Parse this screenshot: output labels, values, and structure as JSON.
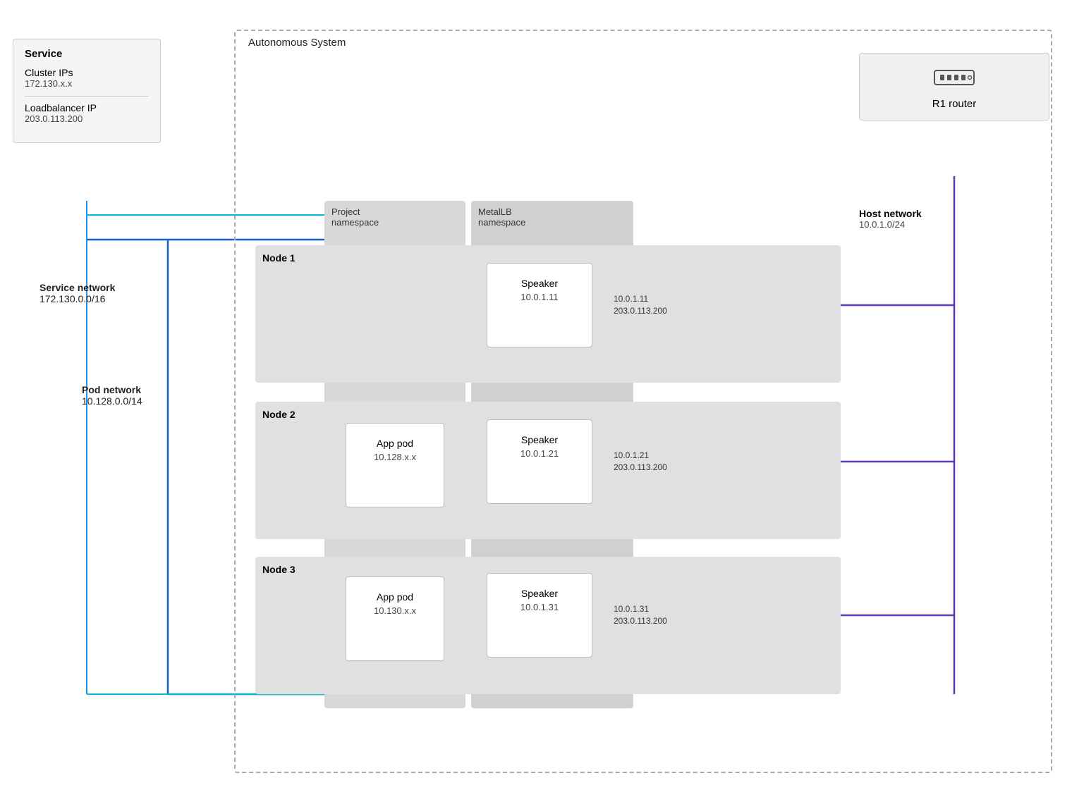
{
  "service": {
    "title": "Service",
    "items": [
      {
        "name": "Cluster IPs",
        "value": "172.130.x.x"
      },
      {
        "name": "Loadbalancer IP",
        "value": "203.0.113.200"
      }
    ]
  },
  "autonomous_system": {
    "label": "Autonomous System"
  },
  "router": {
    "label": "R1 router",
    "icon": "🖥"
  },
  "host_network": {
    "title": "Host network",
    "cidr": "10.0.1.0/24"
  },
  "namespaces": [
    {
      "id": "project",
      "label": "Project\nnamespace"
    },
    {
      "id": "metallb",
      "label": "MetalLB\nnamespace"
    }
  ],
  "nodes": [
    {
      "id": "node1",
      "label": "Node 1"
    },
    {
      "id": "node2",
      "label": "Node 2"
    },
    {
      "id": "node3",
      "label": "Node 3"
    }
  ],
  "pods": [
    {
      "id": "speaker1",
      "name": "Speaker",
      "ip": "10.0.1.11"
    },
    {
      "id": "app2",
      "name": "App pod",
      "ip": "10.128.x.x"
    },
    {
      "id": "speaker2",
      "name": "Speaker",
      "ip": "10.0.1.21"
    },
    {
      "id": "app3",
      "name": "App pod",
      "ip": "10.130.x.x"
    },
    {
      "id": "speaker3",
      "name": "Speaker",
      "ip": "10.0.1.31"
    }
  ],
  "networks": [
    {
      "id": "service",
      "title": "Service network",
      "cidr": "172.130.0.0/16"
    },
    {
      "id": "pod",
      "title": "Pod network",
      "cidr": "10.128.0.0/14"
    }
  ],
  "bgp_announcements": [
    {
      "node": 1,
      "ips": "10.0.1.11\n203.0.113.200"
    },
    {
      "node": 2,
      "ips": "10.0.1.21\n203.0.113.200"
    },
    {
      "node": 3,
      "ips": "10.0.1.31\n203.0.113.200"
    }
  ]
}
